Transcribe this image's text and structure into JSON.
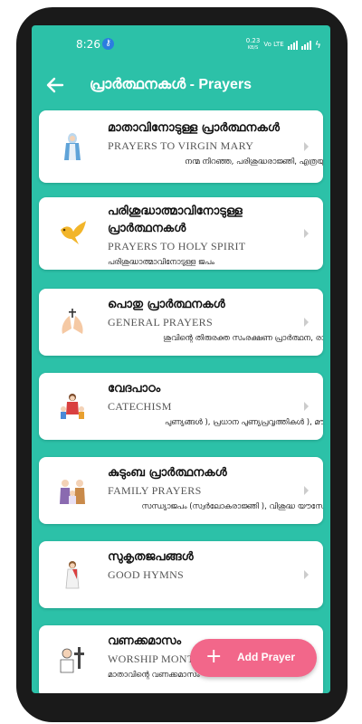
{
  "status": {
    "time": "8:26",
    "vpn_icon": "vpn-key-icon",
    "net_speed": "0.23",
    "net_unit": "KB/S",
    "network": "Vo LTE",
    "battery_icon": "charging-icon"
  },
  "appbar": {
    "title": "പ്രാർത്ഥനകൾ - Prayers",
    "back_icon": "arrow-left-icon"
  },
  "items": [
    {
      "ml": "മാതാവിനോടുള്ള പ്രാർത്ഥനകൾ",
      "en": "PRAYERS TO VIRGIN MARY",
      "sub": "നന്മ നിറഞ്ഞ, പരിശുദ്ധരാജ്ഞി, എത്രയു",
      "icon": "virgin-mary-icon"
    },
    {
      "ml": "പരിശുദ്ധാത്മാവിനോടുള്ള പ്രാർത്ഥനകൾ",
      "en": "PRAYERS TO HOLY SPIRIT",
      "sub": "പരിശുദ്ധാത്മാവിനോടുള്ള ജപം",
      "icon": "dove-icon"
    },
    {
      "ml": "പൊതു പ്രാർത്ഥനകൾ",
      "en": "GENERAL PRAYERS",
      "sub": "ശുവിന്റെ തിരുരക്ത സംരക്ഷണ പ്രാർത്ഥന, രാ",
      "icon": "praying-hands-icon"
    },
    {
      "ml": "വേദപാഠം",
      "en": "CATECHISM",
      "sub": "പുണ്യങ്ങൾ ), പ്രധാന പുണ്യപ്രവൃത്തികൾ ), മൗ",
      "icon": "jesus-children-icon"
    },
    {
      "ml": "കുടുംബ പ്രാർത്ഥനകൾ",
      "en": "FAMILY PRAYERS",
      "sub": "സന്ധ്യാജപം (സ്വർലോകരാജ്ഞി ), വിശുദ്ധ യൗസേ",
      "icon": "holy-family-icon"
    },
    {
      "ml": "സുകൃതജപങ്ങൾ",
      "en": "GOOD HYMNS",
      "sub": "",
      "icon": "jesus-figure-icon"
    },
    {
      "ml": "വണക്കമാസം",
      "en": "WORSHIP MONTH",
      "sub": "മാതാവിന്റെ വണക്കമാസം",
      "icon": "saint-cross-icon"
    }
  ],
  "fab": {
    "label": "Add Prayer",
    "plus": "+"
  },
  "colors": {
    "teal": "#2cc1a8",
    "fab": "#f2678a"
  }
}
